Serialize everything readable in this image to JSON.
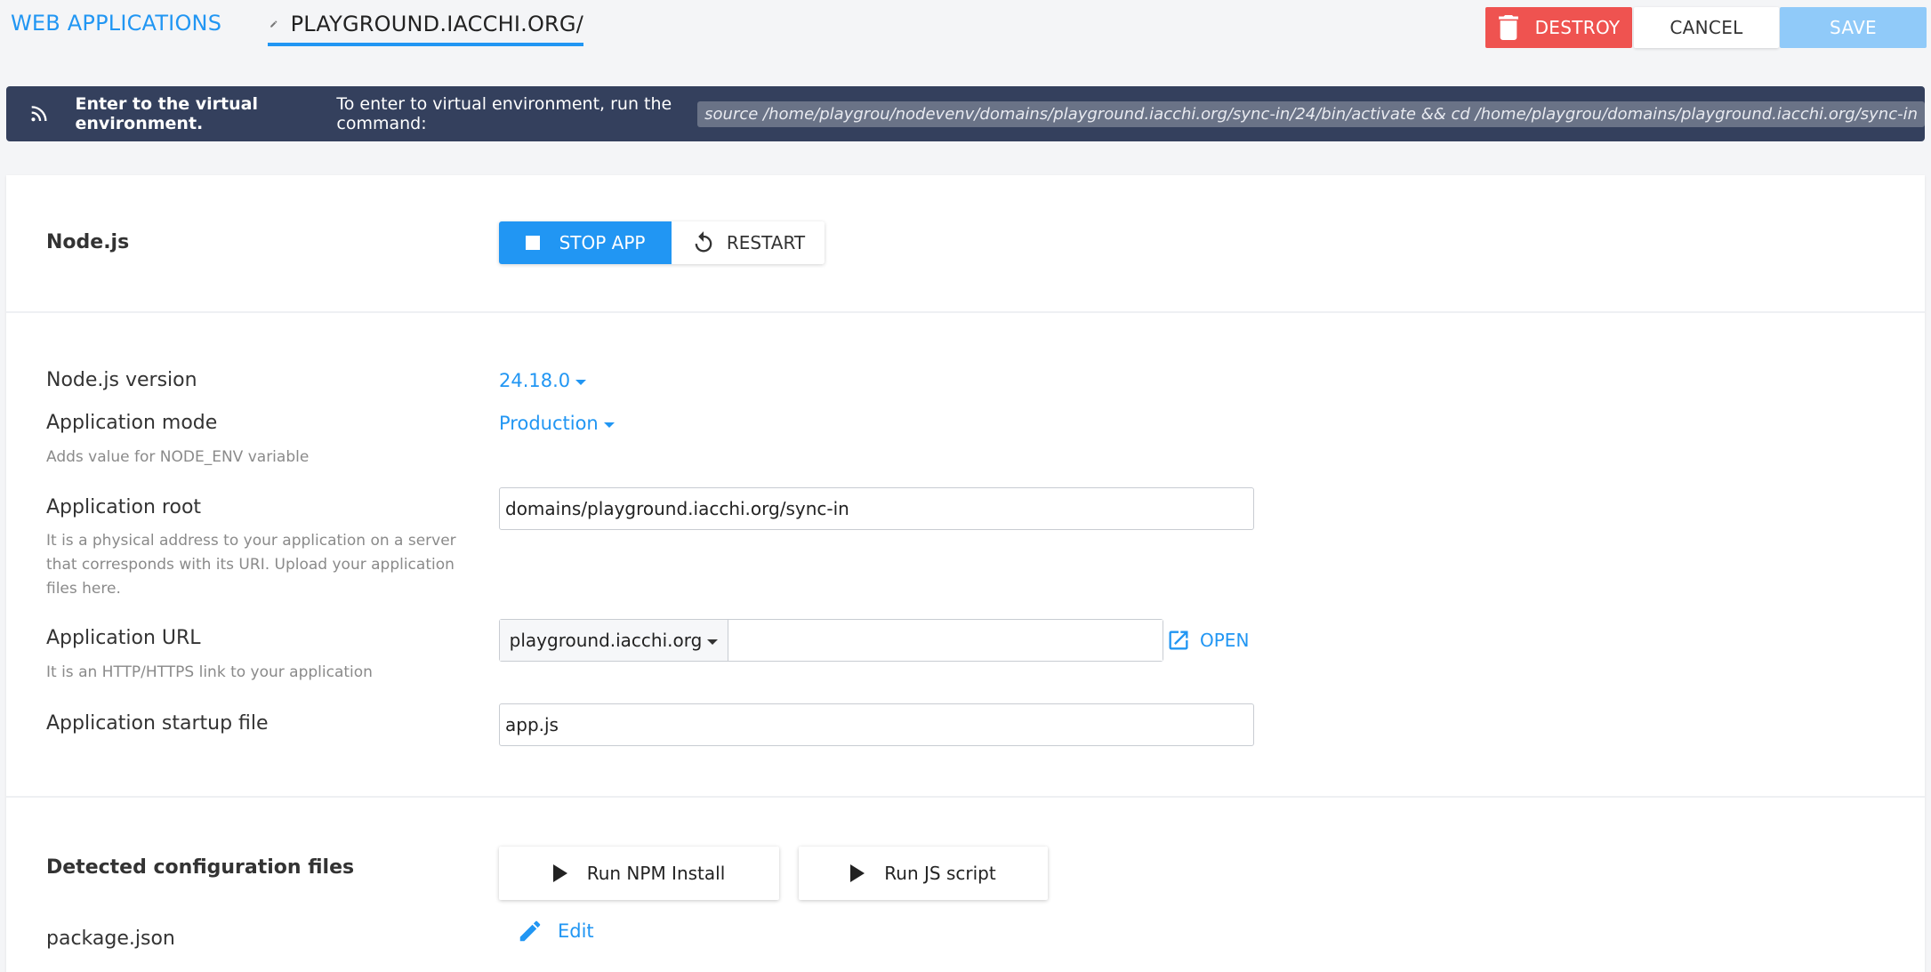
{
  "header": {
    "breadcrumb": "WEB APPLICATIONS",
    "app_title": "PLAYGROUND.IACCHI.ORG/",
    "destroy_label": "DESTROY",
    "cancel_label": "CANCEL",
    "save_label": "SAVE"
  },
  "banner": {
    "title": "Enter to the virtual environment.",
    "text": "To enter to virtual environment, run the command:",
    "command": "source /home/playgrou/nodevenv/domains/playground.iacchi.org/sync-in/24/bin/activate && cd /home/playgrou/domains/playground.iacchi.org/sync-in"
  },
  "app_section": {
    "label": "Node.js",
    "stop_label": "STOP APP",
    "restart_label": "RESTART"
  },
  "config": {
    "node_version_label": "Node.js version",
    "node_version_value": "24.18.0",
    "mode_label": "Application mode",
    "mode_value": "Production",
    "mode_hint": "Adds value for NODE_ENV variable",
    "root_label": "Application root",
    "root_value": "domains/playground.iacchi.org/sync-in",
    "root_hint": "It is a physical address to your application on a server that corresponds with its URI. Upload your application files here.",
    "url_label": "Application URL",
    "url_domain": "playground.iacchi.org",
    "url_path": "",
    "url_hint": "It is an HTTP/HTTPS link to your application",
    "open_label": "OPEN",
    "startup_label": "Application startup file",
    "startup_value": "app.js"
  },
  "detected": {
    "label": "Detected configuration files",
    "npm_install_label": "Run NPM Install",
    "run_js_label": "Run JS script",
    "file_name": "package.json",
    "edit_label": "Edit"
  },
  "colors": {
    "accent": "#2196f3",
    "danger": "#ef5350",
    "save_disabled": "#90caf9",
    "banner_bg": "#34405d"
  },
  "icons": {
    "title": "pencil-icon",
    "destroy": "trash-icon",
    "banner": "rss-icon",
    "stop": "stop-square-icon",
    "restart": "restart-icon",
    "open": "external-link-icon",
    "run": "play-icon",
    "edit": "pencil-icon"
  }
}
